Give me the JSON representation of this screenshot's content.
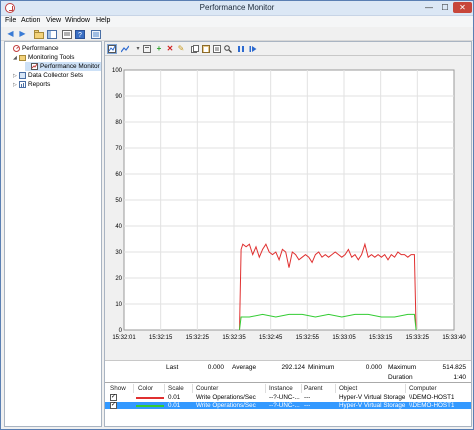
{
  "window": {
    "title": "Performance Monitor",
    "minimize_glyph": "—",
    "maximize_glyph": "☐",
    "close_glyph": "✕"
  },
  "menu": {
    "items": [
      "File",
      "Action",
      "View",
      "Window",
      "Help"
    ]
  },
  "toolbar": {
    "icons": [
      "back-icon",
      "forward-icon",
      "up-icon",
      "show-hide-tree-icon",
      "properties-icon",
      "help-icon",
      "console-icon"
    ]
  },
  "tree": {
    "items": [
      {
        "label": "Performance",
        "level": 0,
        "expander": "",
        "icon": "performance-icon"
      },
      {
        "label": "Monitoring Tools",
        "level": 1,
        "expander": "◢",
        "icon": "folder-icon"
      },
      {
        "label": "Performance Monitor",
        "level": 2,
        "expander": "",
        "icon": "monitor-chart-icon",
        "selected": true
      },
      {
        "label": "Data Collector Sets",
        "level": 1,
        "expander": "▷",
        "icon": "collector-icon"
      },
      {
        "label": "Reports",
        "level": 1,
        "expander": "▷",
        "icon": "report-icon"
      }
    ]
  },
  "perf_toolbar": {
    "icons": [
      "view-current-activity-icon",
      "change-graph-type-icon",
      "view-log-data-icon",
      "add-counter-icon",
      "delete-counter-icon",
      "highlight-icon",
      "copy-properties-icon",
      "paste-counter-list-icon",
      "properties-icon",
      "zoom-icon",
      "freeze-display-icon",
      "update-data-icon"
    ]
  },
  "colors": {
    "accent": "#3399ff",
    "series_red": "#e03030",
    "series_green": "#33cc33",
    "selected_tree": "#cde1f7"
  },
  "chart_data": {
    "type": "line",
    "title": "",
    "ylim": [
      0,
      100
    ],
    "y_ticks": [
      0,
      10,
      20,
      30,
      40,
      50,
      60,
      70,
      80,
      90,
      100
    ],
    "x_tick_labels": [
      "15:32:01",
      "15:32:15",
      "15:32:25",
      "15:32:35",
      "15:32:45",
      "15:32:55",
      "15:33:05",
      "15:33:15",
      "15:33:25",
      "15:33:40"
    ],
    "x_range_seconds": 100,
    "series": [
      {
        "color": "#e03030",
        "points": [
          [
            35,
            0
          ],
          [
            35.5,
            31
          ],
          [
            36,
            33
          ],
          [
            37,
            32
          ],
          [
            38,
            33
          ],
          [
            39,
            29
          ],
          [
            40,
            32
          ],
          [
            41,
            28
          ],
          [
            42,
            31
          ],
          [
            43,
            33
          ],
          [
            44,
            30
          ],
          [
            45,
            29
          ],
          [
            46,
            30
          ],
          [
            47,
            27
          ],
          [
            48,
            31
          ],
          [
            49,
            30
          ],
          [
            50,
            24
          ],
          [
            51,
            30
          ],
          [
            52,
            29
          ],
          [
            53,
            27
          ],
          [
            54,
            28
          ],
          [
            55,
            29
          ],
          [
            56,
            28
          ],
          [
            57,
            26
          ],
          [
            58,
            29
          ],
          [
            59,
            30
          ],
          [
            60,
            28
          ],
          [
            61,
            29
          ],
          [
            62,
            28
          ],
          [
            63,
            29
          ],
          [
            64,
            30
          ],
          [
            65,
            29
          ],
          [
            66,
            28
          ],
          [
            67,
            29
          ],
          [
            68,
            31
          ],
          [
            69,
            28
          ],
          [
            70,
            29
          ],
          [
            71,
            27
          ],
          [
            72,
            29
          ],
          [
            73,
            33
          ],
          [
            74,
            28
          ],
          [
            75,
            29
          ],
          [
            76,
            28
          ],
          [
            77,
            29
          ],
          [
            78,
            28
          ],
          [
            79,
            29
          ],
          [
            80,
            27
          ],
          [
            81,
            29
          ],
          [
            82,
            28
          ],
          [
            83,
            30
          ],
          [
            84,
            29
          ],
          [
            85,
            29
          ],
          [
            86,
            28
          ],
          [
            87,
            29
          ],
          [
            88,
            29
          ],
          [
            88.5,
            0
          ]
        ]
      },
      {
        "color": "#33cc33",
        "points": [
          [
            35,
            0
          ],
          [
            35.5,
            5
          ],
          [
            38,
            5
          ],
          [
            42,
            6
          ],
          [
            46,
            5
          ],
          [
            50,
            6
          ],
          [
            54,
            6
          ],
          [
            58,
            5
          ],
          [
            62,
            6
          ],
          [
            66,
            5
          ],
          [
            70,
            6
          ],
          [
            74,
            6
          ],
          [
            78,
            5
          ],
          [
            82,
            5
          ],
          [
            86,
            6
          ],
          [
            88,
            6
          ],
          [
            88.5,
            0
          ]
        ]
      }
    ]
  },
  "stats": {
    "last_label": "Last",
    "last": "0.000",
    "average_label": "Average",
    "average": "292.124",
    "minimum_label": "Minimum",
    "minimum": "0.000",
    "maximum_label": "Maximum",
    "maximum": "514.825",
    "duration_label": "Duration",
    "duration": "1:40"
  },
  "counter_table": {
    "columns": [
      "Show",
      "Color",
      "Scale",
      "Counter",
      "Instance",
      "Parent",
      "Object",
      "Computer"
    ],
    "rows": [
      {
        "show": true,
        "color": "#e03030",
        "scale": "0.01",
        "counter": "Write Operations/Sec",
        "instance": "--?-UNC-...",
        "parent": "---",
        "object": "Hyper-V Virtual Storage ...",
        "computer": "\\\\DEMO-HOST1",
        "selected": false
      },
      {
        "show": true,
        "color": "#33cc33",
        "scale": "0.01",
        "counter": "Write Operations/Sec",
        "instance": "--?-UNC-...",
        "parent": "---",
        "object": "Hyper-V Virtual Storage ...",
        "computer": "\\\\DEMO-HOST1",
        "selected": true
      }
    ]
  }
}
